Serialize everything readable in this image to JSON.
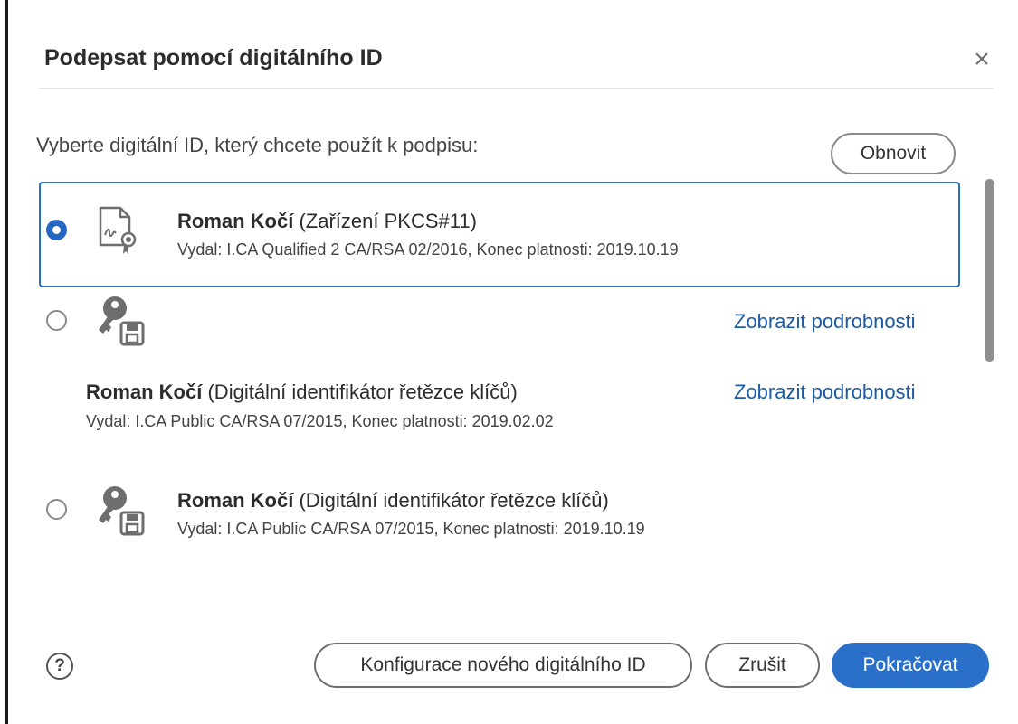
{
  "dialog": {
    "title": "Podepsat pomocí digitálního ID",
    "close_glyph": "×",
    "prompt": "Vyberte digitální ID, který chcete použít k podpisu:",
    "refresh_label": "Obnovit"
  },
  "ids": [
    {
      "name": "Roman Kočí",
      "type": "(Zařízení PKCS#11)",
      "issuer": "Vydal: I.CA Qualified 2 CA/RSA 02/2016, Konec platnosti: 2019.10.19",
      "selected": true,
      "icon": "certificate-icon"
    },
    {
      "link": "Zobrazit podrobnosti",
      "selected": false,
      "icon": "key-disk-icon"
    },
    {
      "name": "Roman Kočí",
      "type": "(Digitální identifikátor řetězce klíčů)",
      "issuer": "Vydal: I.CA Public CA/RSA 07/2015, Konec platnosti: 2019.02.02",
      "link": "Zobrazit podrobnosti"
    },
    {
      "name": "Roman Kočí",
      "type": "(Digitální identifikátor řetězce klíčů)",
      "issuer": "Vydal: I.CA Public CA/RSA 07/2015, Konec platnosti: 2019.10.19",
      "selected": false,
      "icon": "key-disk-icon"
    }
  ],
  "footer": {
    "help_glyph": "?",
    "configure_label": "Konfigurace nového digitálního ID",
    "cancel_label": "Zrušit",
    "continue_label": "Pokračovat"
  },
  "colors": {
    "accent": "#2a70c9",
    "link": "#1b5aa6",
    "selection_border": "#2d6fc2"
  }
}
